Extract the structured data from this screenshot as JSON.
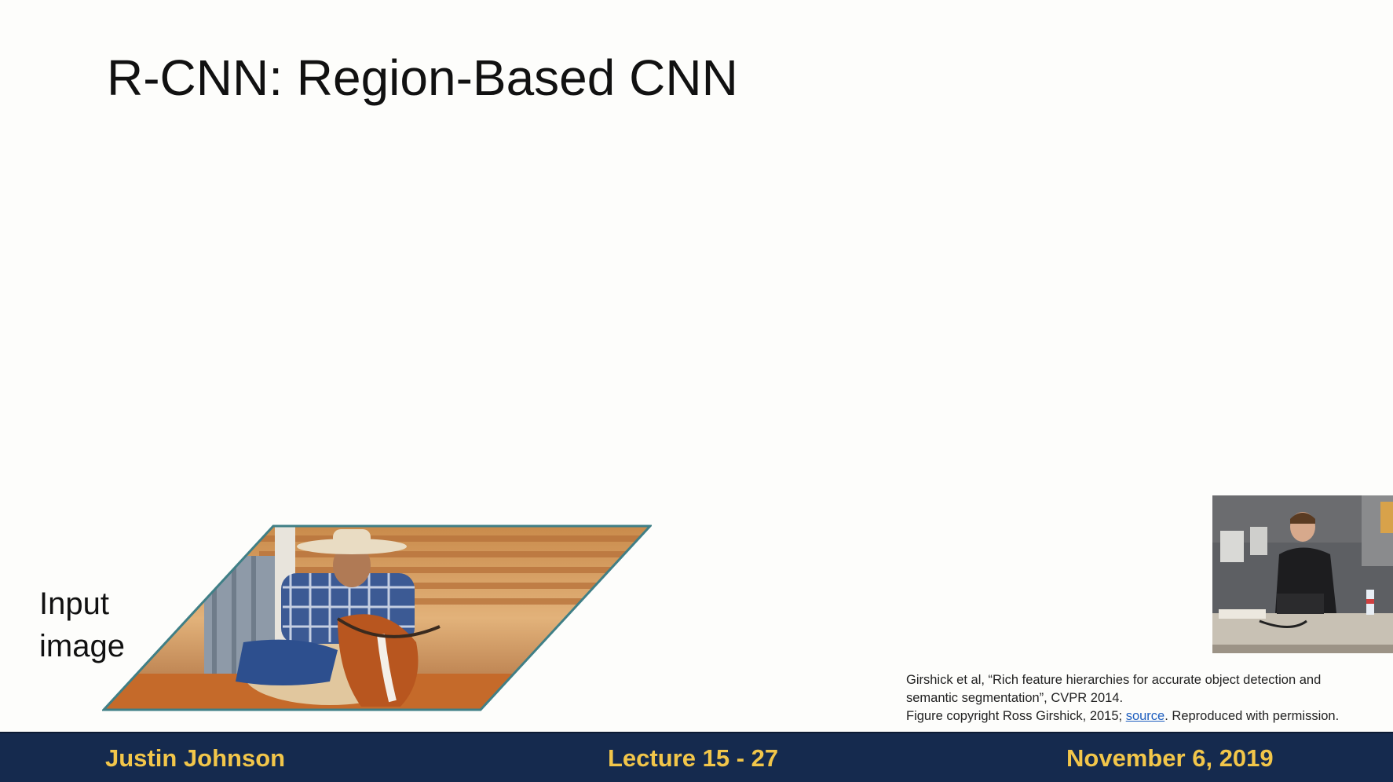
{
  "slide": {
    "title": "R-CNN: Region-Based CNN",
    "input_label_line1": "Input",
    "input_label_line2": "image",
    "citation": {
      "line1": "Girshick et al, “Rich feature hierarchies for accurate object detection and",
      "line2": "semantic segmentation”, CVPR 2014.",
      "line3_prefix": "Figure copyright Ross Girshick, 2015; ",
      "line3_link": "source",
      "line3_suffix": ". Reproduced with permission."
    }
  },
  "footer": {
    "author": "Justin Johnson",
    "lecture": "Lecture 15 - 27",
    "date": "November 6, 2019"
  },
  "colors": {
    "footer_bg": "#152a4e",
    "footer_text": "#f2c64a",
    "link": "#1f5fbf"
  }
}
